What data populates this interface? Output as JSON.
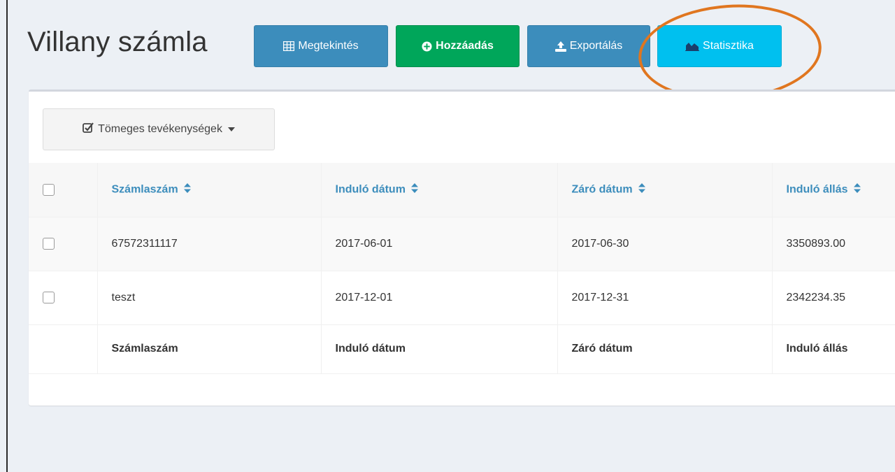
{
  "page": {
    "title": "Villany számla"
  },
  "toolbar": {
    "view_label": "Megtekintés",
    "add_label": "Hozzáadás",
    "export_label": "Exportálás",
    "stats_label": "Statisztika"
  },
  "bulk": {
    "label": "Tömeges tevékenységek"
  },
  "table": {
    "columns": [
      "Számlaszám",
      "Induló dátum",
      "Záró dátum",
      "Induló állás"
    ],
    "rows": [
      [
        "67572311117",
        "2017-06-01",
        "2017-06-30",
        "3350893.00"
      ],
      [
        "teszt",
        "2017-12-01",
        "2017-12-31",
        "2342234.35"
      ]
    ]
  },
  "icons": {
    "view": "table-icon",
    "add": "plus-circle-icon",
    "export": "upload-icon",
    "stats": "area-chart-icon",
    "bulk": "checkbox-icon",
    "sort": "sort-icon"
  },
  "colors": {
    "primary": "#3c8dbc",
    "success": "#00a65a",
    "info": "#00c0ef",
    "highlight": "#e0761f"
  }
}
